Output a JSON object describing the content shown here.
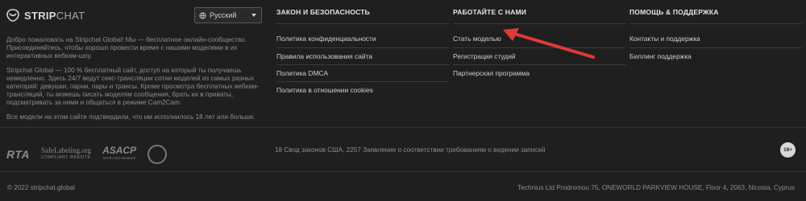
{
  "brand": {
    "name_strong": "STRIP",
    "name_rest": "CHAT"
  },
  "language": {
    "selected": "Русский"
  },
  "about": {
    "p1": "Добро пожаловать на Stripchat Global! Мы — бесплатное онлайн-сообщество. Присоединяйтесь, чтобы хорошо провести время с нашими моделями в их интерактивных вебкам-шоу.",
    "p2": "Stripchat Global — 100 % бесплатный сайт, доступ на который ты получаешь немедленно. Здесь 24/7 ведут секс-трансляции сотни моделей из самых разных категорий: девушки, парни, пары и трансы. Кроме просмотра бесплатных вебкам-трансляций, ты можешь писать моделям сообщения, брать их в приваты, подсматривать за ними и общаться в режиме Cam2Cam.",
    "p3": "Все модели на этом сайте подтвердили, что им исполнилось 18 лет или больше."
  },
  "columns": [
    {
      "title": "ЗАКОН И БЕЗОПАСНОСТЬ",
      "links": [
        "Политика конфиденциальности",
        "Правила использования сайта",
        "Политика DMCA",
        "Политика в отношении cookies"
      ]
    },
    {
      "title": "РАБОТАЙТЕ С НАМИ",
      "links": [
        "Стать моделью",
        "Регистрация студий",
        "Партнерская программа"
      ]
    },
    {
      "title": "ПОМОЩЬ & ПОДДЕРЖКА",
      "links": [
        "Контакты и поддержка",
        "Биллинг поддержка"
      ]
    }
  ],
  "logos": {
    "rta": "RTA",
    "safelabel_big": "SafeLabeling.org",
    "safelabel_small": "COMPLIANT WEBSITE",
    "asacp_big": "ASACP",
    "asacp_small": "APPROVED MEMBER"
  },
  "legal": "18 Свод законов США, 2257 Заявление о соответствии требованиям о ведении записей",
  "age_badge": "18+",
  "copyright": "© 2022 stripchat.global",
  "address": "Technius Ltd Prodromou 75, ONEWORLD PARKVIEW HOUSE, Floor 4, 2063, Nicosia, Cyprus",
  "colors": {
    "background": "#1f1f1f",
    "annotation_arrow": "#e03a3a"
  }
}
